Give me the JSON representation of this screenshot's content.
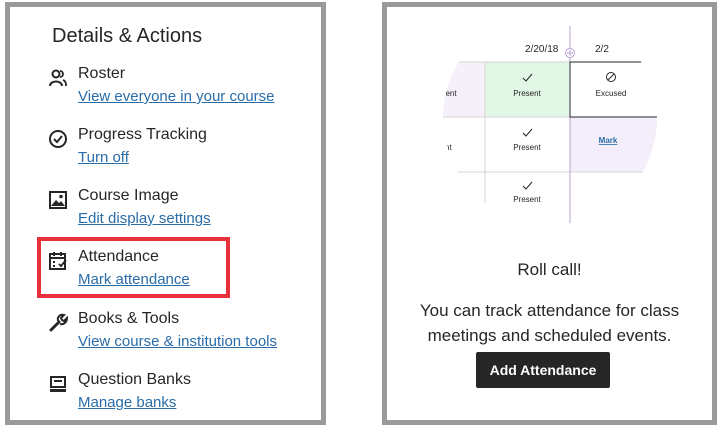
{
  "details": {
    "heading": "Details & Actions",
    "items": [
      {
        "title": "Roster",
        "link": "View everyone in your course",
        "icon": "roster-icon"
      },
      {
        "title": "Progress Tracking",
        "link": "Turn off",
        "icon": "progress-check-icon"
      },
      {
        "title": "Course Image",
        "link": "Edit display settings",
        "icon": "image-icon"
      },
      {
        "title": "Attendance",
        "link": "Mark attendance",
        "icon": "attendance-calendar-icon"
      },
      {
        "title": "Books & Tools",
        "link": "View course & institution tools",
        "icon": "wrench-icon"
      },
      {
        "title": "Question Banks",
        "link": "Manage banks",
        "icon": "question-bank-icon"
      }
    ],
    "highlight_color": "#e8303a",
    "link_color": "#2a6ca8"
  },
  "roll_call": {
    "grid": {
      "date_1": "2/20/18",
      "date_2": "2/2",
      "present_partial": "esent",
      "present": "Present",
      "excused": "Excused",
      "nt_partial": "nt",
      "mark": "Mark"
    },
    "title": "Roll call!",
    "description_line1": "You can track attendance for class",
    "description_line2": "meetings and scheduled events.",
    "button_label": "Add Attendance",
    "present_color": "#e3f7e6",
    "accent_color": "#b9a0d6"
  }
}
